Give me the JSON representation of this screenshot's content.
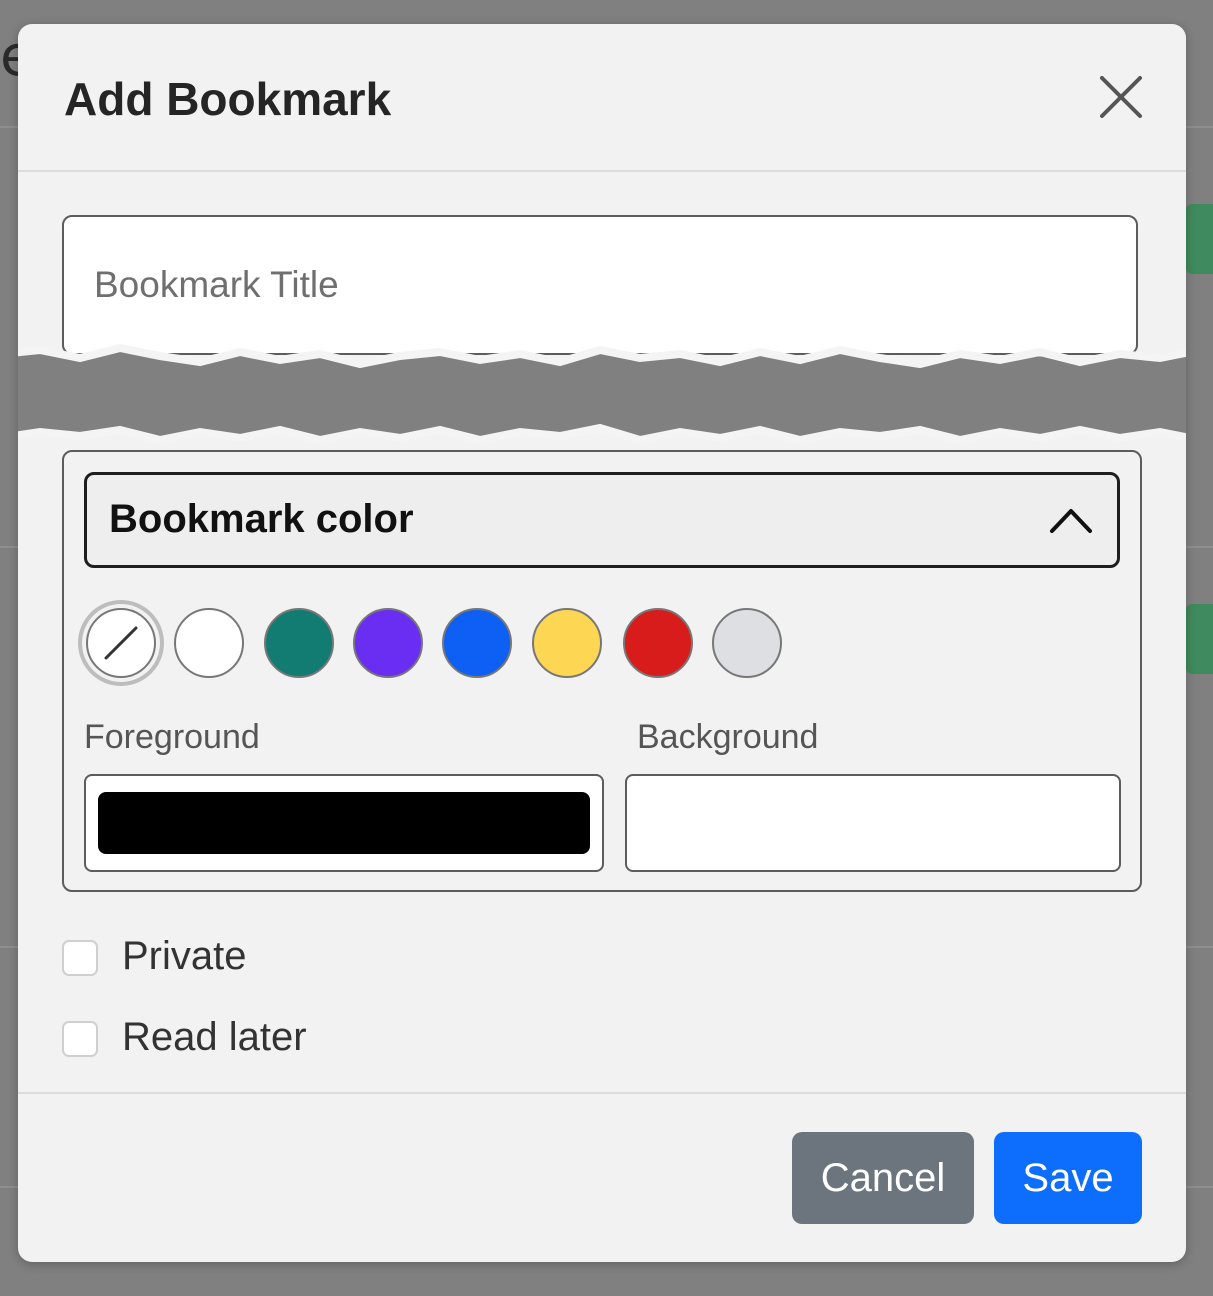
{
  "modal": {
    "title": "Add Bookmark",
    "close_icon": "close-icon"
  },
  "title_input": {
    "placeholder": "Bookmark Title",
    "value": ""
  },
  "color_section": {
    "label": "Bookmark color",
    "toggle_icon": "chevron-up-icon",
    "expanded": true,
    "swatches": [
      {
        "name": "none",
        "color": "#ffffff",
        "icon": "slash-icon",
        "selected": true
      },
      {
        "name": "white",
        "color": "#ffffff",
        "selected": false
      },
      {
        "name": "teal",
        "color": "#127c73",
        "selected": false
      },
      {
        "name": "purple",
        "color": "#6a2ef2",
        "selected": false
      },
      {
        "name": "blue",
        "color": "#0d60f3",
        "selected": false
      },
      {
        "name": "yellow",
        "color": "#fdd753",
        "selected": false
      },
      {
        "name": "red",
        "color": "#d81c1c",
        "selected": false
      },
      {
        "name": "light-gray",
        "color": "#dddfe2",
        "selected": false
      }
    ],
    "foreground": {
      "label": "Foreground",
      "color": "#000000"
    },
    "background": {
      "label": "Background",
      "color": "#ffffff"
    }
  },
  "options": {
    "private_label": "Private",
    "private_checked": false,
    "read_later_label": "Read later",
    "read_later_checked": false
  },
  "footer": {
    "cancel_label": "Cancel",
    "cancel_color": "#6c757d",
    "save_label": "Save",
    "save_color": "#0d6efd"
  }
}
